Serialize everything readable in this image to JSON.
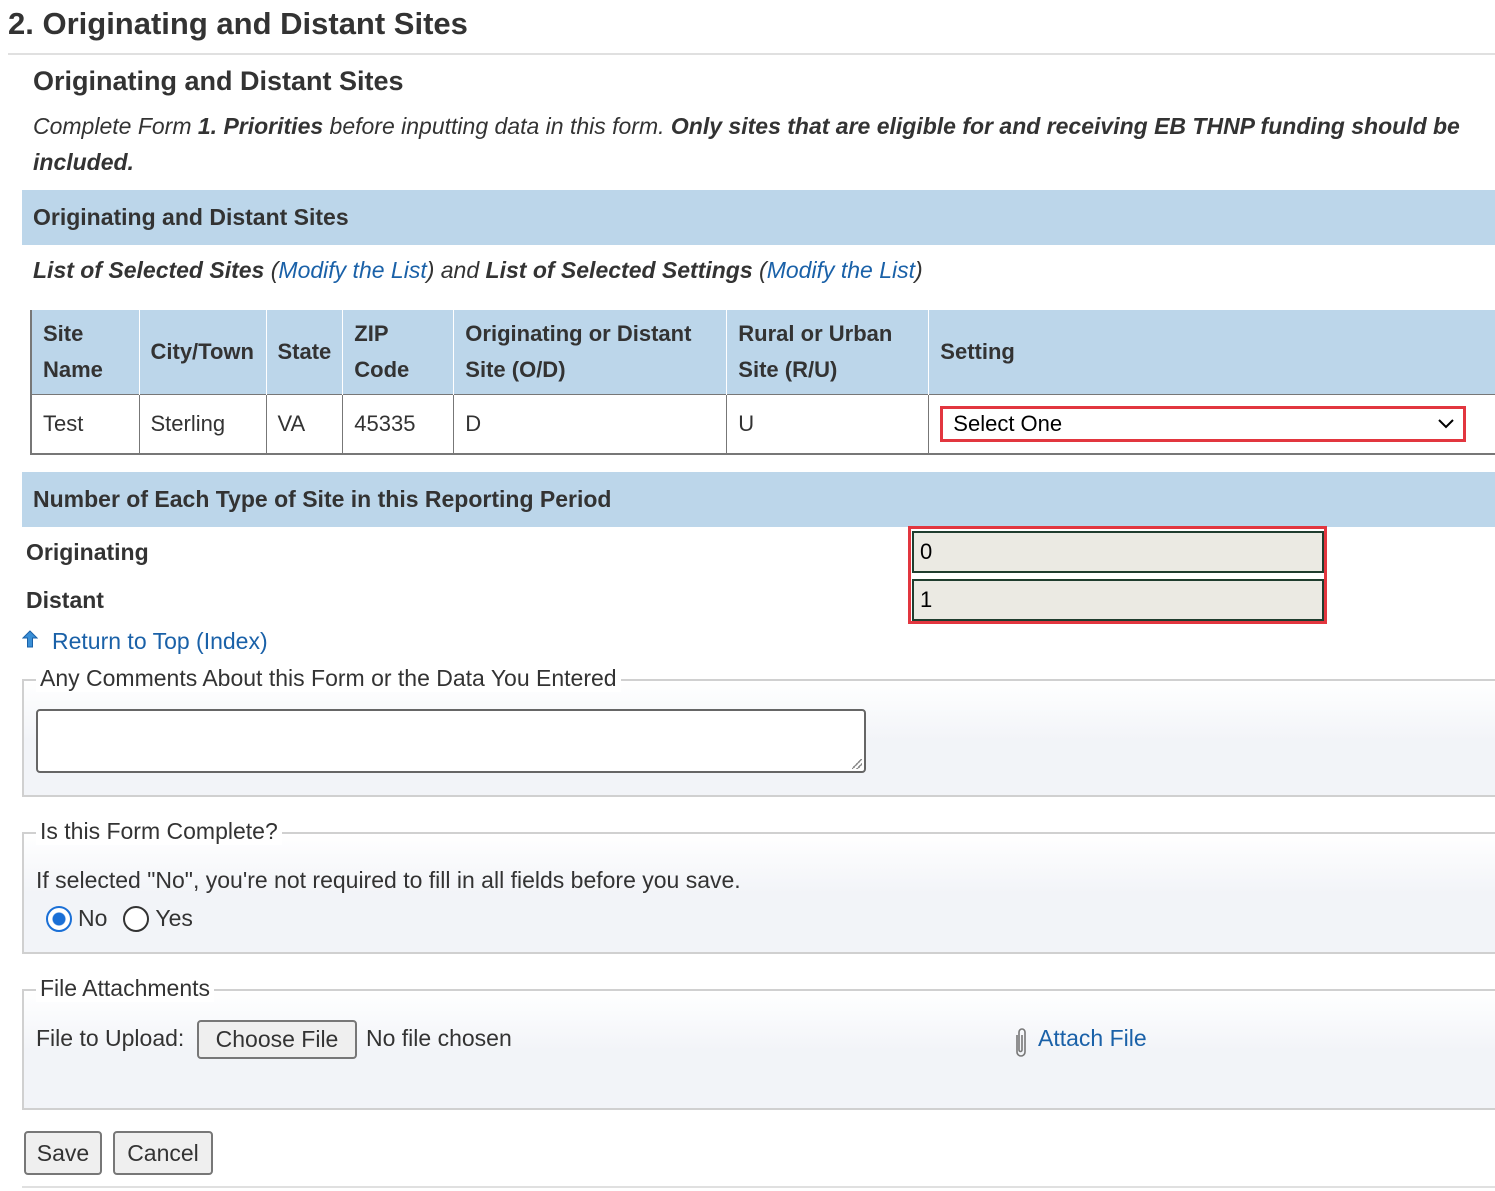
{
  "page": {
    "title": "2. Originating and Distant Sites",
    "subtitle": "Originating and Distant Sites",
    "instructions": {
      "part1": "Complete Form ",
      "bold_ref": "1. Priorities",
      "part2": " before inputting data in this form. ",
      "bold_note": "Only sites that are eligible for and receiving EB THNP funding should be included."
    }
  },
  "sites_section": {
    "header": "Originating and Distant Sites",
    "list_sites_label": "List of Selected Sites",
    "open_paren": " (",
    "modify_link_1": "Modify the List",
    "mid_text": ") and ",
    "list_settings_label": "List of Selected Settings",
    "modify_link_2": "Modify the List",
    "close_paren": ")",
    "columns": {
      "site_name": "Site Name",
      "city": "City/Town",
      "state": "State",
      "zip": "ZIP Code",
      "od": "Originating or Distant Site (O/D)",
      "ru": "Rural or Urban Site (R/U)",
      "setting": "Setting"
    },
    "rows": [
      {
        "site_name": "Test",
        "city": "Sterling",
        "state": "VA",
        "zip": "45335",
        "od": "D",
        "ru": "U",
        "setting": "Select One"
      }
    ]
  },
  "counts_section": {
    "header": "Number of Each Type of Site in this Reporting Period",
    "originating_label": "Originating",
    "originating_value": "0",
    "distant_label": "Distant",
    "distant_value": "1"
  },
  "return_link": "Return to Top (Index)",
  "comments": {
    "legend": "Any Comments About this Form or the Data You Entered",
    "value": ""
  },
  "complete": {
    "legend": "Is this Form Complete?",
    "note": "If selected \"No\", you're not required to fill in all fields before you save.",
    "options": [
      "No",
      "Yes"
    ],
    "selected": "No"
  },
  "attachments": {
    "legend": "File Attachments",
    "upload_label": "File to Upload:",
    "choose_button": "Choose File",
    "no_file": "No file chosen",
    "attach_link": "Attach File"
  },
  "actions": {
    "save": "Save",
    "cancel": "Cancel"
  },
  "colors": {
    "section_bar": "#bcd6ea",
    "link": "#1a61a8",
    "highlight": "#e2363f",
    "radio_selected": "#1a6fd6"
  }
}
